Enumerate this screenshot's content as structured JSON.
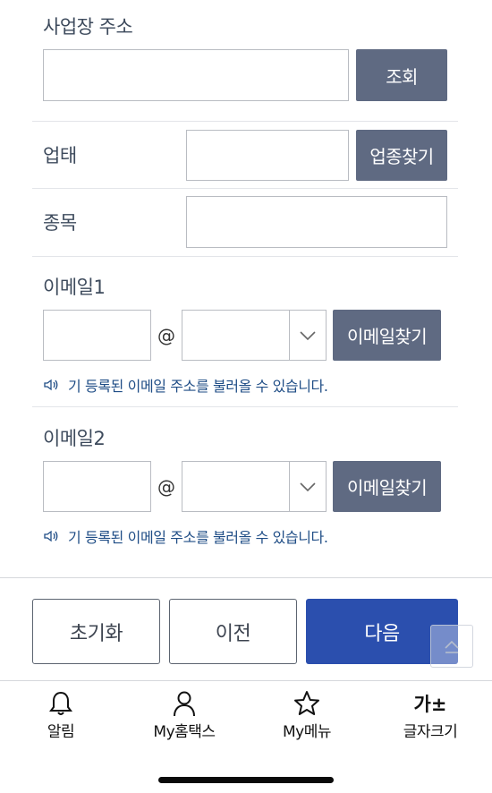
{
  "address": {
    "label": "사업장 주소",
    "value": "",
    "search_button": "조회"
  },
  "business_type": {
    "label": "업태",
    "value": "",
    "search_button": "업종찾기"
  },
  "item": {
    "label": "종목",
    "value": ""
  },
  "email1": {
    "label": "이메일1",
    "local_part": "",
    "at_sign": "@",
    "domain": "",
    "search_button": "이메일찾기",
    "hint": "기 등록된 이메일 주소를 불러올 수 있습니다."
  },
  "email2": {
    "label": "이메일2",
    "local_part": "",
    "at_sign": "@",
    "domain": "",
    "search_button": "이메일찾기",
    "hint": "기 등록된 이메일 주소를 불러올 수 있습니다."
  },
  "actions": {
    "reset": "초기화",
    "previous": "이전",
    "next": "다음"
  },
  "tabbar": {
    "items": [
      {
        "label": "알림",
        "icon": "bell-icon"
      },
      {
        "label": "My홈택스",
        "icon": "person-icon"
      },
      {
        "label": "My메뉴",
        "icon": "star-icon"
      },
      {
        "label": "글자크기",
        "icon": "font-size-icon",
        "icon_text": "가±"
      }
    ]
  },
  "colors": {
    "dark_button": "#5f6a82",
    "primary": "#2b4fae",
    "hint_text": "#1f4d86"
  }
}
